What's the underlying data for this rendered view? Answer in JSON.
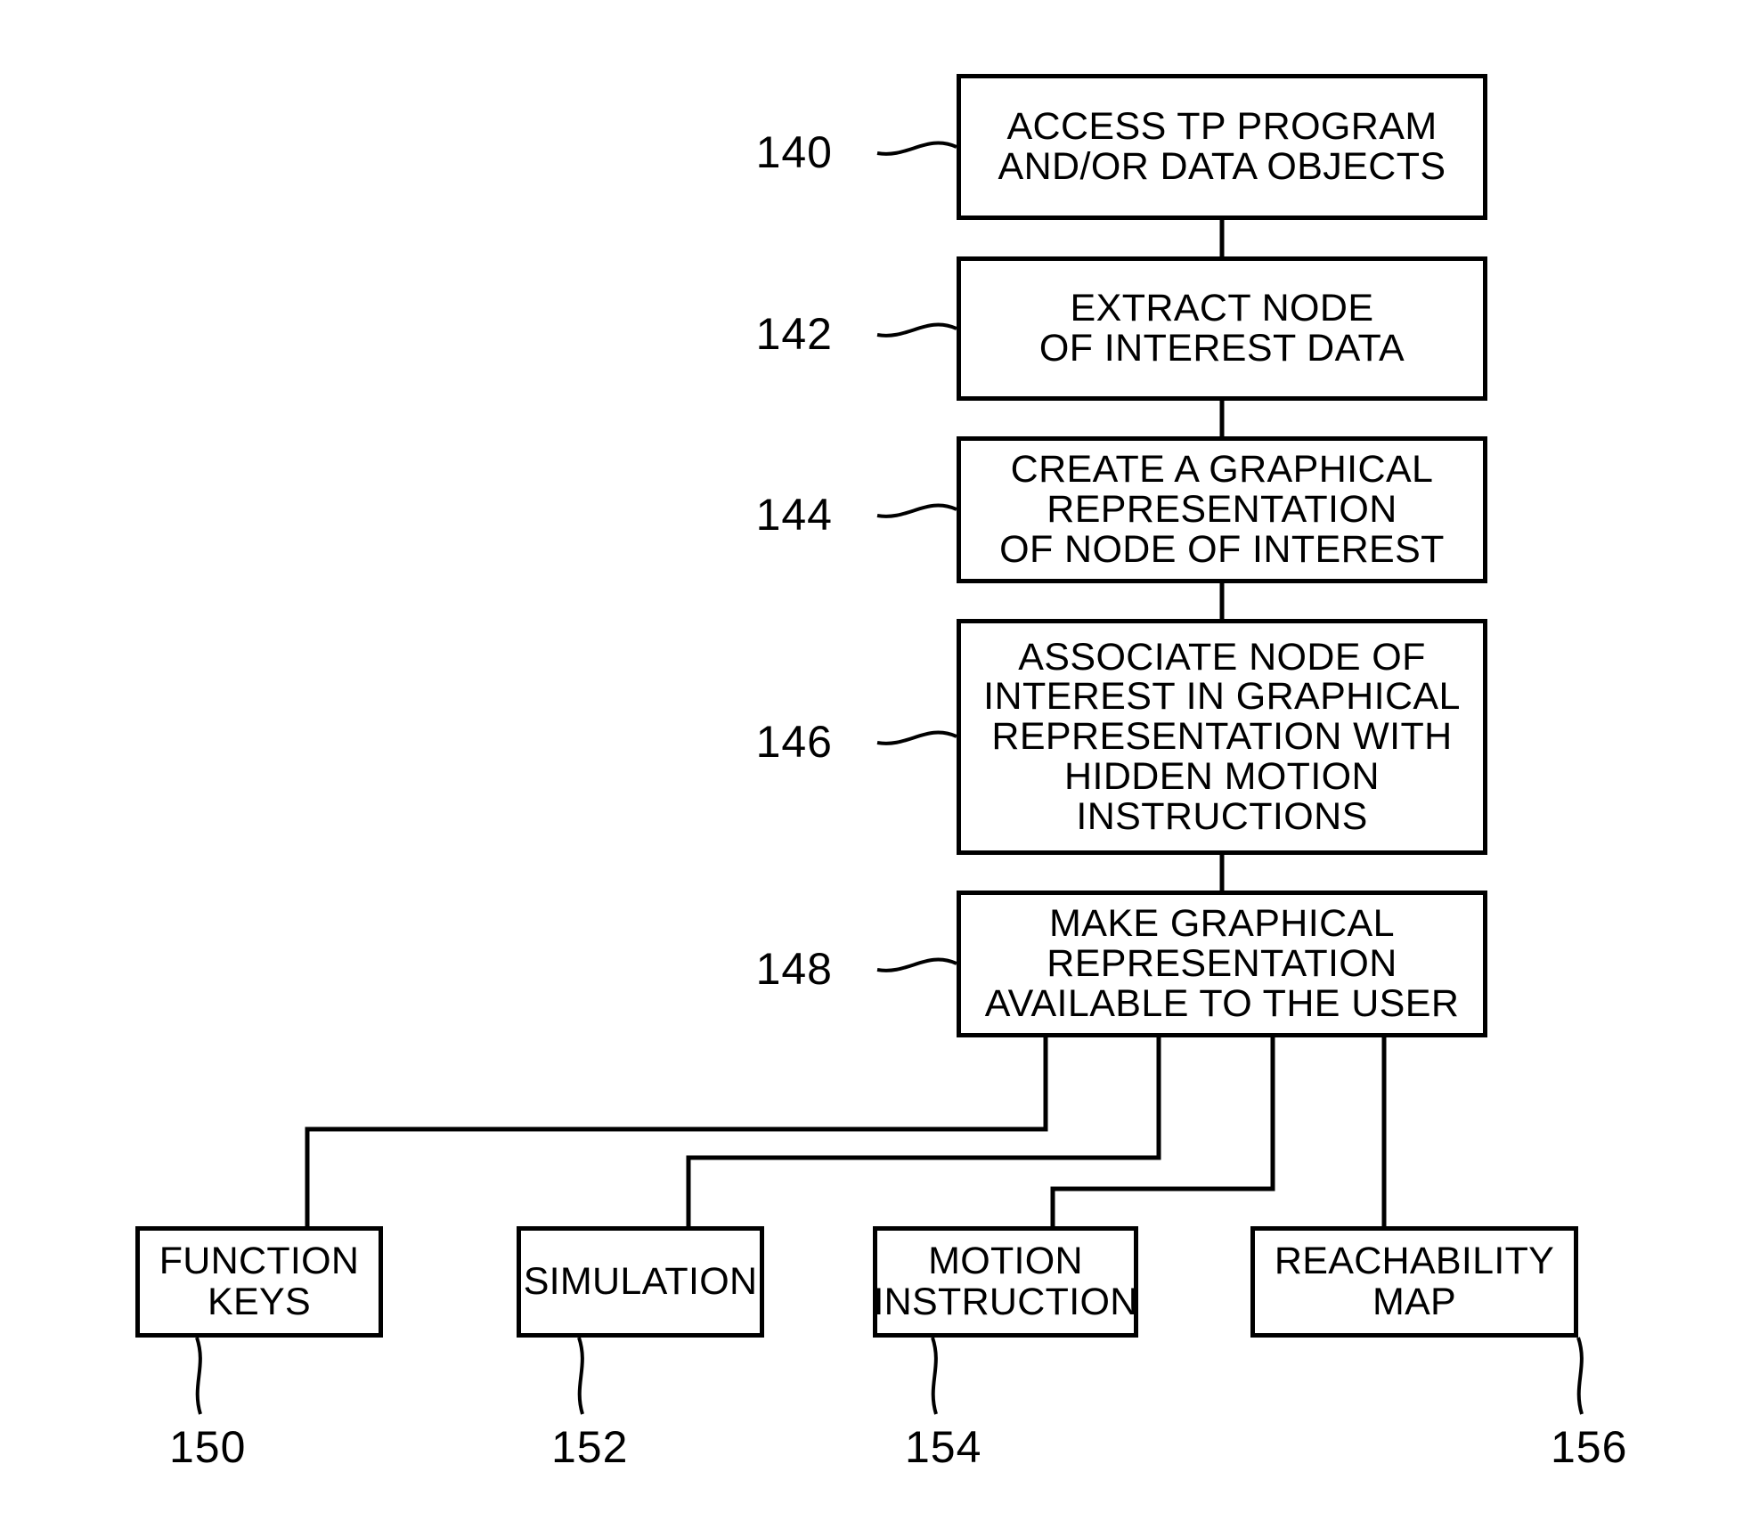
{
  "figure": {
    "type": "patent-flowchart",
    "orientation": "top-down",
    "background": "#ffffff",
    "line_color": "#000000"
  },
  "process_steps": [
    {
      "ref": "140",
      "text": "ACCESS TP PROGRAM\nAND/OR DATA OBJECTS",
      "name": "access-tp-program"
    },
    {
      "ref": "142",
      "text": "EXTRACT NODE\nOF INTEREST DATA",
      "name": "extract-node-of-interest-data"
    },
    {
      "ref": "144",
      "text": "CREATE A GRAPHICAL\nREPRESENTATION\nOF NODE OF INTEREST",
      "name": "create-graphical-representation"
    },
    {
      "ref": "146",
      "text": "ASSOCIATE NODE OF\nINTEREST IN GRAPHICAL\nREPRESENTATION WITH\nHIDDEN MOTION\nINSTRUCTIONS",
      "name": "associate-node-with-hidden-motion-instructions"
    },
    {
      "ref": "148",
      "text": "MAKE GRAPHICAL\nREPRESENTATION\nAVAILABLE TO THE USER",
      "name": "make-representation-available"
    }
  ],
  "outputs": [
    {
      "ref": "150",
      "text": "FUNCTION KEYS",
      "name": "function-keys"
    },
    {
      "ref": "152",
      "text": "SIMULATION",
      "name": "simulation"
    },
    {
      "ref": "154",
      "text": "MOTION\nINSTRUCTION",
      "name": "motion-instruction"
    },
    {
      "ref": "156",
      "text": "REACHABILITY\nMAP",
      "name": "reachability-map"
    }
  ]
}
